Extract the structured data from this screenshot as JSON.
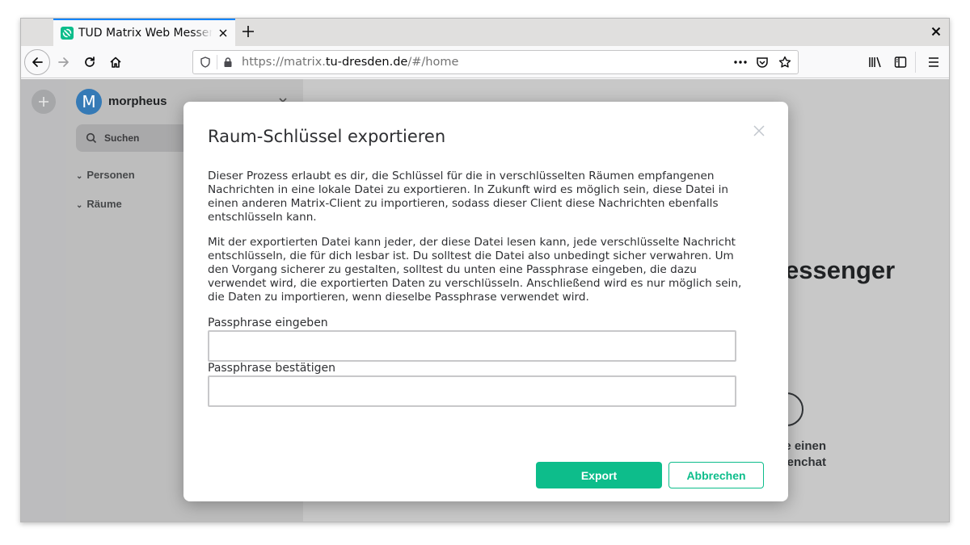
{
  "browser": {
    "tab_title": "TUD Matrix Web Messenger",
    "url_prefix": "https://matrix.",
    "url_host": "tu-dresden.de",
    "url_path": "/#/home"
  },
  "sidebar": {
    "avatar_letter": "M",
    "username": "morpheus",
    "search_placeholder": "Suchen",
    "sections": [
      {
        "label": "Personen"
      },
      {
        "label": "Räume"
      }
    ]
  },
  "welcome": {
    "title_fragment": "essenger",
    "cta_line1": "e einen",
    "cta_line2": "enchat"
  },
  "dialog": {
    "title": "Raum-Schlüssel exportieren",
    "paragraph1": "Dieser Prozess erlaubt es dir, die Schlüssel für die in verschlüsselten Räumen empfangenen Nachrichten in eine lokale Datei zu exportieren. In Zukunft wird es möglich sein, diese Datei in einen anderen Matrix-Client zu importieren, sodass dieser Client diese Nachrichten ebenfalls entschlüsseln kann.",
    "paragraph2": "Mit der exportierten Datei kann jeder, der diese Datei lesen kann, jede verschlüsselte Nachricht entschlüsseln, die für dich lesbar ist. Du solltest die Datei also unbedingt sicher verwahren. Um den Vorgang sicherer zu gestalten, solltest du unten eine Passphrase eingeben, die dazu verwendet wird, die exportierten Daten zu verschlüsseln. Anschließend wird es nur möglich sein, die Daten zu importieren, wenn dieselbe Passphrase verwendet wird.",
    "passphrase_label": "Passphrase eingeben",
    "passphrase_value": "",
    "confirm_label": "Passphrase bestätigen",
    "confirm_value": "",
    "export_button": "Export",
    "cancel_button": "Abbrechen"
  },
  "colors": {
    "accent": "#0dbd8b",
    "tab_highlight": "#0a84ff",
    "overlay": "#c3c3c3"
  }
}
